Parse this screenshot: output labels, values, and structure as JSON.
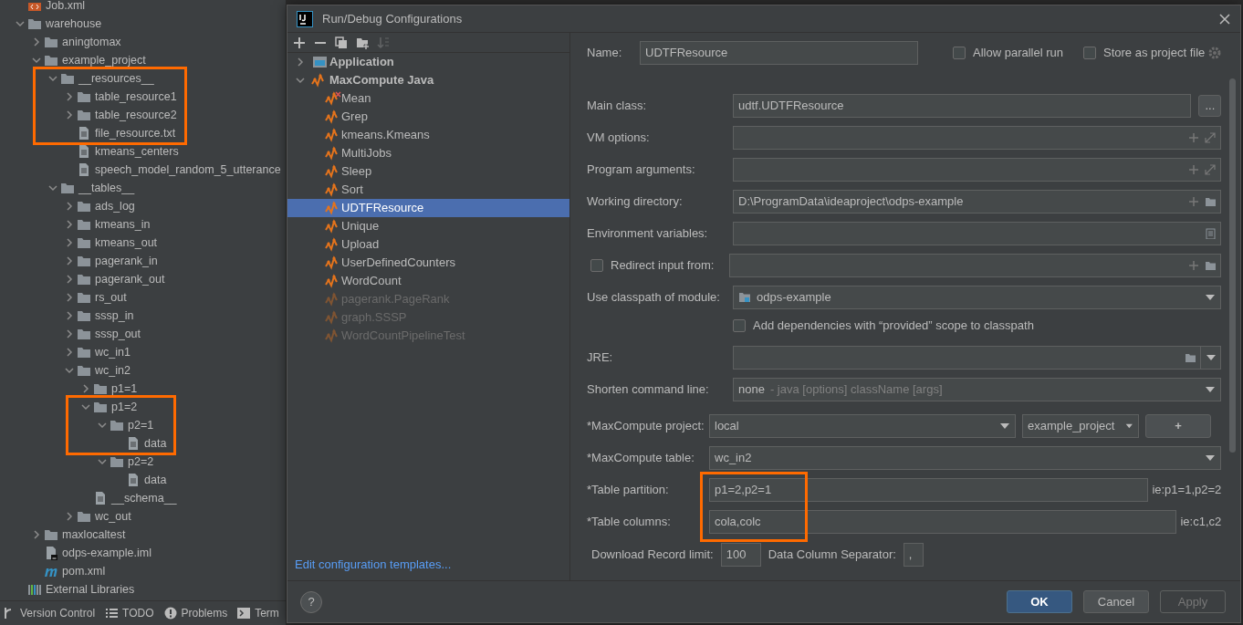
{
  "project_tree": [
    {
      "name": "Job.xml",
      "kind": "xml"
    },
    {
      "name": "warehouse",
      "kind": "folder",
      "expanded": true,
      "children": [
        {
          "name": "aningtomax",
          "kind": "folder",
          "expanded": false
        },
        {
          "name": "example_project",
          "kind": "folder",
          "expanded": true,
          "children": [
            {
              "name": "__resources__",
              "kind": "folder",
              "expanded": true,
              "highlighted": true,
              "children": [
                {
                  "name": "table_resource1",
                  "kind": "folder",
                  "expanded": false,
                  "highlighted": true
                },
                {
                  "name": "table_resource2",
                  "kind": "folder",
                  "expanded": false,
                  "highlighted": true
                },
                {
                  "name": "file_resource.txt",
                  "kind": "file",
                  "highlighted": true
                },
                {
                  "name": "kmeans_centers",
                  "kind": "file"
                },
                {
                  "name": "speech_model_random_5_utterance",
                  "kind": "file"
                }
              ]
            },
            {
              "name": "__tables__",
              "kind": "folder",
              "expanded": true,
              "children": [
                {
                  "name": "ads_log",
                  "kind": "folder",
                  "expanded": false
                },
                {
                  "name": "kmeans_in",
                  "kind": "folder",
                  "expanded": false
                },
                {
                  "name": "kmeans_out",
                  "kind": "folder",
                  "expanded": false
                },
                {
                  "name": "pagerank_in",
                  "kind": "folder",
                  "expanded": false
                },
                {
                  "name": "pagerank_out",
                  "kind": "folder",
                  "expanded": false
                },
                {
                  "name": "rs_out",
                  "kind": "folder",
                  "expanded": false
                },
                {
                  "name": "sssp_in",
                  "kind": "folder",
                  "expanded": false
                },
                {
                  "name": "sssp_out",
                  "kind": "folder",
                  "expanded": false
                },
                {
                  "name": "wc_in1",
                  "kind": "folder",
                  "expanded": false
                },
                {
                  "name": "wc_in2",
                  "kind": "folder",
                  "expanded": true,
                  "children": [
                    {
                      "name": "p1=1",
                      "kind": "folder",
                      "expanded": false
                    },
                    {
                      "name": "p1=2",
                      "kind": "folder",
                      "expanded": true,
                      "highlighted": true,
                      "children": [
                        {
                          "name": "p2=1",
                          "kind": "folder",
                          "expanded": true,
                          "highlighted": true,
                          "children": [
                            {
                              "name": "data",
                              "kind": "file",
                              "highlighted": true
                            }
                          ]
                        },
                        {
                          "name": "p2=2",
                          "kind": "folder",
                          "expanded": true,
                          "children": [
                            {
                              "name": "data",
                              "kind": "file"
                            }
                          ]
                        }
                      ]
                    },
                    {
                      "name": "__schema__",
                      "kind": "file"
                    }
                  ]
                },
                {
                  "name": "wc_out",
                  "kind": "folder",
                  "expanded": false
                }
              ]
            }
          ]
        },
        {
          "name": "maxlocaltest",
          "kind": "folder",
          "expanded": false
        },
        {
          "name": "odps-example.iml",
          "kind": "iml"
        },
        {
          "name": "pom.xml",
          "kind": "maven"
        }
      ]
    },
    {
      "name": "External Libraries",
      "kind": "library"
    }
  ],
  "tool_tabs": [
    {
      "label": "Version Control",
      "kind": "vcs"
    },
    {
      "label": "TODO",
      "kind": "todo"
    },
    {
      "label": "Problems",
      "kind": "problems"
    },
    {
      "label": "Term",
      "kind": "terminal"
    }
  ],
  "dialog": {
    "title": "Run/Debug Configurations",
    "toolbar": [
      {
        "kind": "add",
        "disabled": false
      },
      {
        "kind": "remove",
        "disabled": false
      },
      {
        "kind": "copy",
        "disabled": false
      },
      {
        "kind": "folder",
        "disabled": false
      },
      {
        "kind": "sort",
        "disabled": true
      }
    ],
    "config_tree": [
      {
        "name": "Application",
        "kind": "application",
        "expanded": false
      },
      {
        "name": "MaxCompute Java",
        "kind": "maxcompute",
        "expanded": true,
        "children": [
          {
            "name": "Mean",
            "selected": false,
            "disabled": false,
            "error": true
          },
          {
            "name": "Grep",
            "selected": false,
            "disabled": false,
            "error": false
          },
          {
            "name": "kmeans.Kmeans",
            "selected": false,
            "disabled": false,
            "error": false
          },
          {
            "name": "MultiJobs",
            "selected": false,
            "disabled": false,
            "error": false
          },
          {
            "name": "Sleep",
            "selected": false,
            "disabled": false,
            "error": false
          },
          {
            "name": "Sort",
            "selected": false,
            "disabled": false,
            "error": false
          },
          {
            "name": "UDTFResource",
            "selected": true,
            "disabled": false,
            "error": false
          },
          {
            "name": "Unique",
            "selected": false,
            "disabled": false,
            "error": false
          },
          {
            "name": "Upload",
            "selected": false,
            "disabled": false,
            "error": false
          },
          {
            "name": "UserDefinedCounters",
            "selected": false,
            "disabled": false,
            "error": false
          },
          {
            "name": "WordCount",
            "selected": false,
            "disabled": false,
            "error": false
          },
          {
            "name": "pagerank.PageRank",
            "selected": false,
            "disabled": true,
            "error": false
          },
          {
            "name": "graph.SSSP",
            "selected": false,
            "disabled": true,
            "error": false
          },
          {
            "name": "WordCountPipelineTest",
            "selected": false,
            "disabled": true,
            "error": false
          }
        ]
      }
    ],
    "templates_link": "Edit configuration templates...",
    "help_label": "?",
    "name_field": {
      "label": "Name:",
      "value": "UDTFResource"
    },
    "options": [
      {
        "label": "Allow parallel run",
        "checked": false
      },
      {
        "label": "Store as project file",
        "checked": false
      }
    ],
    "fields": [
      {
        "kind": "text",
        "label": "Main class:",
        "value": "udtf.UDTFResource",
        "browse": "..."
      },
      {
        "kind": "expandable",
        "label": "VM options:"
      },
      {
        "kind": "expandable",
        "label": "Program arguments:"
      },
      {
        "kind": "directory",
        "label": "Working directory:",
        "value": "D:\\ProgramData\\ideaproject\\odps-example"
      },
      {
        "kind": "env",
        "label": "Environment variables:"
      },
      {
        "kind": "redirect",
        "label": "Redirect input from:",
        "checked": false
      },
      {
        "kind": "module",
        "label": "Use classpath of module:",
        "value": "odps-example"
      },
      {
        "kind": "checkbox",
        "label": "Add dependencies with “provided” scope to classpath",
        "checked": false
      },
      {
        "kind": "jre",
        "label": "JRE:"
      },
      {
        "kind": "shorten",
        "label": "Shorten command line:",
        "value": "none",
        "hint": "- java [options] className [args]"
      },
      {
        "kind": "project",
        "label": "*MaxCompute project:",
        "value": "local",
        "project": "example_project",
        "add": "+"
      },
      {
        "kind": "table",
        "label": "*MaxCompute table:",
        "value": "wc_in2"
      },
      {
        "kind": "partition",
        "label": "*Table partition:",
        "value": "p1=2,p2=1",
        "hint": "ie:p1=1,p2=2",
        "highlighted": true
      },
      {
        "kind": "partition",
        "label": "*Table columns:",
        "value": "cola,colc",
        "hint": "ie:c1,c2",
        "highlighted": true
      }
    ],
    "footer": {
      "download_label": "Download Record limit:",
      "download_value": "100",
      "separator_label": "Data Column Separator:",
      "separator_value": ","
    },
    "buttons": [
      {
        "label": "OK",
        "kind": "primary",
        "disabled": false
      },
      {
        "label": "Cancel",
        "kind": "secondary",
        "disabled": false
      },
      {
        "label": "Apply",
        "kind": "secondary",
        "disabled": true
      }
    ]
  }
}
